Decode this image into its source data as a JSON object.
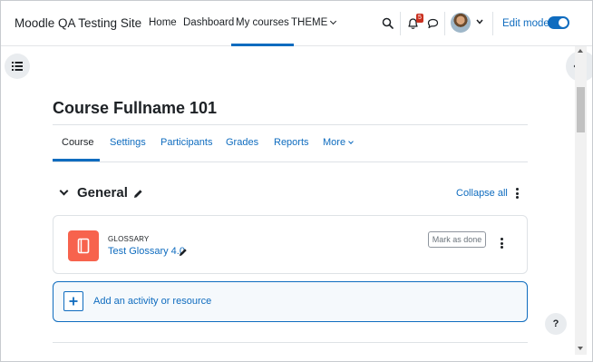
{
  "navbar": {
    "site_name": "Moodle QA Testing Site",
    "links": [
      "Home",
      "Dashboard",
      "My courses",
      "THEME"
    ],
    "active_link": "My courses",
    "notification_count": "5",
    "edit_mode_label": "Edit mode",
    "edit_mode_on": true
  },
  "course": {
    "title": "Course Fullname 101",
    "tabs": [
      "Course",
      "Settings",
      "Participants",
      "Grades",
      "Reports",
      "More"
    ],
    "active_tab": "Course"
  },
  "section": {
    "title": "General",
    "collapse_all_label": "Collapse all"
  },
  "activity": {
    "type_label": "GLOSSARY",
    "name": "Test Glossary 4.0",
    "mark_done_label": "Mark as done",
    "icon": "glossary-icon",
    "icon_color": "#f7634d"
  },
  "add_activity": {
    "label": "Add an activity or resource"
  },
  "help": {
    "label": "?"
  },
  "colors": {
    "primary": "#0f6cbf",
    "text": "#1d2125",
    "badge": "#ca3120"
  }
}
